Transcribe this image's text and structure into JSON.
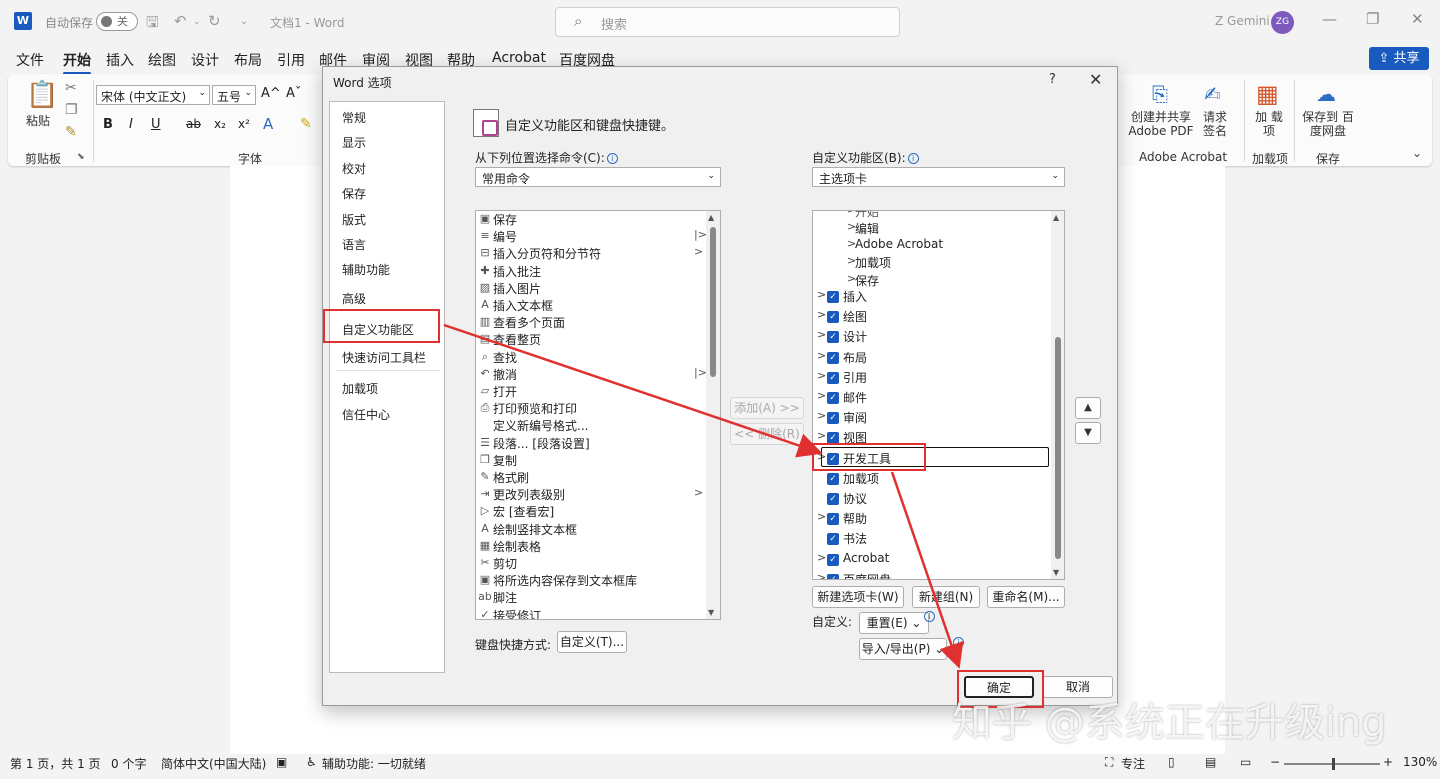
{
  "titlebar": {
    "app_logo": "W",
    "autosave_label": "自动保存",
    "autosave_state": "关",
    "doc_title": "文档1 - Word",
    "search_placeholder": "搜索",
    "user_name": "Z Gemini",
    "user_initials": "ZG"
  },
  "tabs": [
    "文件",
    "开始",
    "插入",
    "绘图",
    "设计",
    "布局",
    "引用",
    "邮件",
    "审阅",
    "视图",
    "帮助",
    "Acrobat",
    "百度网盘"
  ],
  "share_label": "共享",
  "ribbon": {
    "paste_label": "粘贴",
    "clipboard_group": "剪贴板",
    "font_name": "宋体 (中文正文)",
    "font_size": "五号",
    "font_group": "字体",
    "format_buttons": [
      "B",
      "I",
      "U",
      "ab",
      "x₂",
      "x²",
      "A"
    ],
    "acrobat_btn1": "创建并共享 Adobe PDF",
    "acrobat_btn2": "请求 签名",
    "acrobat_group": "Adobe Acrobat",
    "addin_btn": "加 载项",
    "addin_group": "加载项",
    "save_btn": "保存到 百度网盘",
    "save_group": "保存"
  },
  "dialog": {
    "title": "Word 选项",
    "help": "?",
    "close": "✕",
    "nav": [
      "常规",
      "显示",
      "校对",
      "保存",
      "版式",
      "语言",
      "辅助功能",
      "高级",
      "自定义功能区",
      "快速访问工具栏",
      "加载项",
      "信任中心"
    ],
    "heading": "自定义功能区和键盘快捷键。",
    "choose_from_label": "从下列位置选择命令(C):",
    "choose_from_value": "常用命令",
    "customize_label": "自定义功能区(B):",
    "customize_value": "主选项卡",
    "commands": [
      {
        "label": "保存",
        "icon": "save-icon",
        "glyph": "▣",
        "arrow": ""
      },
      {
        "label": "编号",
        "icon": "numbering-icon",
        "glyph": "≡",
        "arrow": "|>"
      },
      {
        "label": "插入分页符和分节符",
        "icon": "page-break-icon",
        "glyph": "⊟",
        "arrow": ">"
      },
      {
        "label": "插入批注",
        "icon": "comment-icon",
        "glyph": "✚",
        "arrow": ""
      },
      {
        "label": "插入图片",
        "icon": "picture-icon",
        "glyph": "▨",
        "arrow": ""
      },
      {
        "label": "插入文本框",
        "icon": "textbox-icon",
        "glyph": "A",
        "arrow": ""
      },
      {
        "label": "查看多个页面",
        "icon": "multi-page-icon",
        "glyph": "▥",
        "arrow": ""
      },
      {
        "label": "查看整页",
        "icon": "whole-page-icon",
        "glyph": "▤",
        "arrow": ""
      },
      {
        "label": "查找",
        "icon": "find-icon",
        "glyph": "⌕",
        "arrow": ""
      },
      {
        "label": "撤消",
        "icon": "undo-icon",
        "glyph": "↶",
        "arrow": "|>"
      },
      {
        "label": "打开",
        "icon": "open-icon",
        "glyph": "▱",
        "arrow": ""
      },
      {
        "label": "打印预览和打印",
        "icon": "print-preview-icon",
        "glyph": "⎙",
        "arrow": ""
      },
      {
        "label": "定义新编号格式...",
        "icon": "blank-icon",
        "glyph": "",
        "arrow": ""
      },
      {
        "label": "段落... [段落设置]",
        "icon": "paragraph-icon",
        "glyph": "☰",
        "arrow": ""
      },
      {
        "label": "复制",
        "icon": "copy-icon",
        "glyph": "❐",
        "arrow": ""
      },
      {
        "label": "格式刷",
        "icon": "format-painter-icon",
        "glyph": "✎",
        "arrow": ""
      },
      {
        "label": "更改列表级别",
        "icon": "list-level-icon",
        "glyph": "⇥",
        "arrow": ">"
      },
      {
        "label": "宏 [查看宏]",
        "icon": "macro-icon",
        "glyph": "▷",
        "arrow": ""
      },
      {
        "label": "绘制竖排文本框",
        "icon": "vertical-textbox-icon",
        "glyph": "A",
        "arrow": ""
      },
      {
        "label": "绘制表格",
        "icon": "draw-table-icon",
        "glyph": "▦",
        "arrow": ""
      },
      {
        "label": "剪切",
        "icon": "cut-icon",
        "glyph": "✂",
        "arrow": ""
      },
      {
        "label": "将所选内容保存到文本框库",
        "icon": "save-selection-icon",
        "glyph": "▣",
        "arrow": ""
      },
      {
        "label": "脚注",
        "icon": "footnote-icon",
        "glyph": "ab",
        "arrow": ""
      },
      {
        "label": "接受修订",
        "icon": "accept-revision-icon",
        "glyph": "✓",
        "arrow": ""
      }
    ],
    "tree_partial_top": "开始",
    "tree_sub": [
      "编辑",
      "Adobe Acrobat",
      "加载项",
      "保存"
    ],
    "tree": [
      {
        "label": "插入",
        "expand": ">"
      },
      {
        "label": "绘图",
        "expand": ">"
      },
      {
        "label": "设计",
        "expand": ">"
      },
      {
        "label": "布局",
        "expand": ">"
      },
      {
        "label": "引用",
        "expand": ">"
      },
      {
        "label": "邮件",
        "expand": ">"
      },
      {
        "label": "审阅",
        "expand": ">"
      },
      {
        "label": "视图",
        "expand": ">"
      },
      {
        "label": "开发工具",
        "expand": ">"
      },
      {
        "label": "加载项",
        "expand": ""
      },
      {
        "label": "协议",
        "expand": ""
      },
      {
        "label": "帮助",
        "expand": ">"
      },
      {
        "label": "书法",
        "expand": ""
      },
      {
        "label": "Acrobat",
        "expand": ">"
      },
      {
        "label": "百度网盘",
        "expand": ">"
      }
    ],
    "add_button": "添加(A) >>",
    "remove_button": "<< 删除(R)",
    "move_up": "▲",
    "move_down": "▼",
    "new_tab_button": "新建选项卡(W)",
    "new_group_button": "新建组(N)",
    "rename_button": "重命名(M)...",
    "customize_label2": "自定义:",
    "reset_button": "重置(E) ⌄",
    "import_export_button": "导入/导出(P) ⌄",
    "keyboard_label": "键盘快捷方式:",
    "keyboard_button": "自定义(T)...",
    "ok_button": "确定",
    "cancel_button": "取消"
  },
  "statusbar": {
    "page": "第 1 页，共 1 页",
    "words": "0 个字",
    "language": "简体中文(中国大陆)",
    "accessibility": "辅助功能: 一切就绪",
    "focus": "专注",
    "zoom": "130%"
  },
  "watermark": "知乎 @系统正在升级ing",
  "colors": {
    "accent": "#185abd",
    "highlight": "#e03030"
  }
}
